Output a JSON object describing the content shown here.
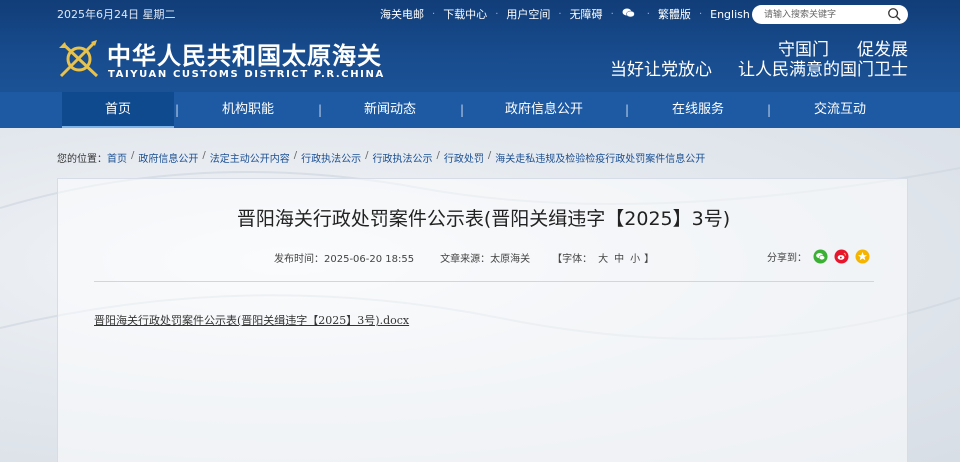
{
  "header": {
    "date": "2025年6月24日 星期二",
    "top_links": [
      {
        "label": "海关电邮"
      },
      {
        "label": "下载中心"
      },
      {
        "label": "用户空间"
      },
      {
        "label": "无障碍"
      },
      {
        "label": ""
      },
      {
        "label": "繁體版"
      },
      {
        "label": "English"
      }
    ],
    "search_placeholder": "请输入搜索关键字",
    "logo_cn": "中华人民共和国太原海关",
    "logo_en": "TAIYUAN CUSTOMS DISTRICT P.R.CHINA",
    "slogan": {
      "line1a": "守国门",
      "line1b": "促发展",
      "line2a": "当好让党放心",
      "line2b": "让人民满意的国门卫士"
    }
  },
  "nav": {
    "items": [
      "首页",
      "机构职能",
      "新闻动态",
      "政府信息公开",
      "在线服务",
      "交流互动"
    ],
    "separator": "|"
  },
  "breadcrumb": {
    "label": "您的位置：",
    "items": [
      "首页",
      "政府信息公开",
      "法定主动公开内容",
      "行政执法公示",
      "行政执法公示",
      "行政处罚",
      "海关走私违规及检验检疫行政处罚案件信息公开"
    ],
    "separator": "/"
  },
  "article": {
    "title": "晋阳海关行政处罚案件公示表(晋阳关缉违字【2025】3号)",
    "publish_time": "发布时间：2025-06-20 18:55",
    "source": "文章来源：太原海关",
    "font_size_label": "【字体：",
    "font_sizes": [
      "大",
      "中",
      "小"
    ],
    "font_size_end": "】",
    "share_label": "分享到：",
    "attachment": "晋阳海关行政处罚案件公示表(晋阳关缉违字【2025】3号).docx"
  },
  "colors": {
    "header_bg": "#184c8e",
    "nav_bg": "#1d5aa3",
    "nav_active": "#0f4a8f",
    "wechat": "#3cb034",
    "weibo": "#e6162d",
    "qzone": "#f5b400"
  },
  "icons": [
    "customs-emblem-icon",
    "wechat-icon",
    "search-icon",
    "share-wechat-icon",
    "share-weibo-icon",
    "share-qzone-icon"
  ]
}
